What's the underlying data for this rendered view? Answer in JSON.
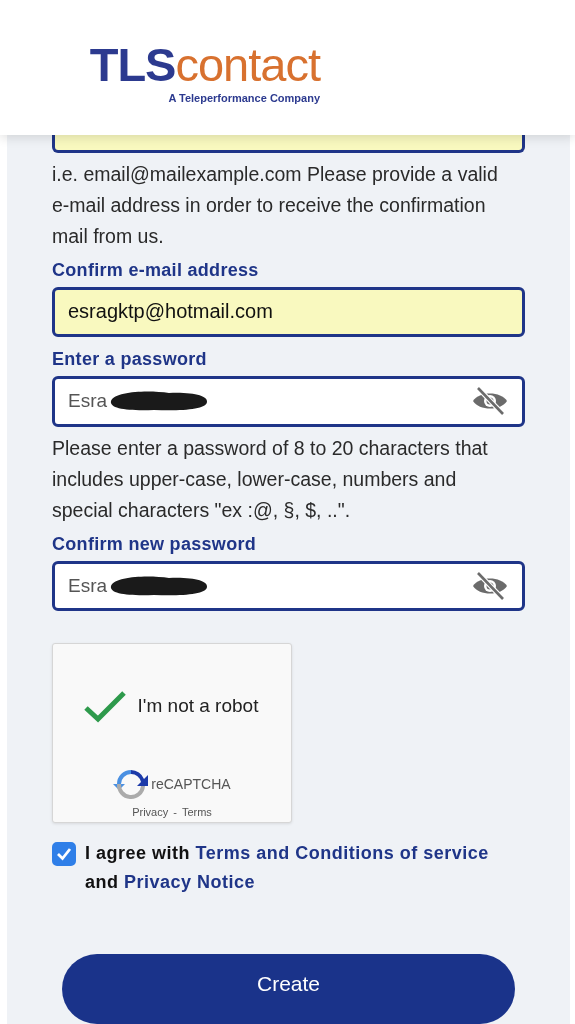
{
  "header": {
    "logo": {
      "part_1": "TLS",
      "part_2": "contact",
      "tagline": "A Teleperformance Company"
    }
  },
  "form": {
    "items": [
      {
        "kind": "field",
        "cut": true,
        "filled": true
      },
      {
        "kind": "help",
        "text": "i.e. email@mailexample.com Please provide a valid e-mail address in order to receive the confirmation mail from us."
      },
      {
        "kind": "label",
        "text": "Confirm e-mail address"
      },
      {
        "kind": "field",
        "value": "esragktp@hotmail.com",
        "filled": true
      },
      {
        "kind": "label",
        "text": "Enter a password"
      },
      {
        "kind": "password",
        "value": "Esra",
        "redacted": true,
        "visible": true
      },
      {
        "kind": "help",
        "text": "Please enter a password of 8 to 20 characters that includes upper-case, lower-case, numbers and special characters \"ex :@, §, $, ..\"."
      },
      {
        "kind": "label",
        "text": "Confirm new password"
      },
      {
        "kind": "password",
        "value": "Esra",
        "redacted": true,
        "visible": true
      }
    ]
  },
  "captcha": {
    "verified": true,
    "text": "I'm not a robot",
    "brand": "reCAPTCHA",
    "links": [
      "Privacy",
      "Terms"
    ],
    "separator": "-"
  },
  "agreement": {
    "checked": true,
    "parts": [
      {
        "kind": "text",
        "text": "I agree with "
      },
      {
        "kind": "link",
        "text": "Terms and Conditions of service"
      },
      {
        "kind": "text",
        "text": " and "
      },
      {
        "kind": "link",
        "text": "Privacy Notice"
      }
    ]
  },
  "submit": {
    "label": "Create"
  }
}
